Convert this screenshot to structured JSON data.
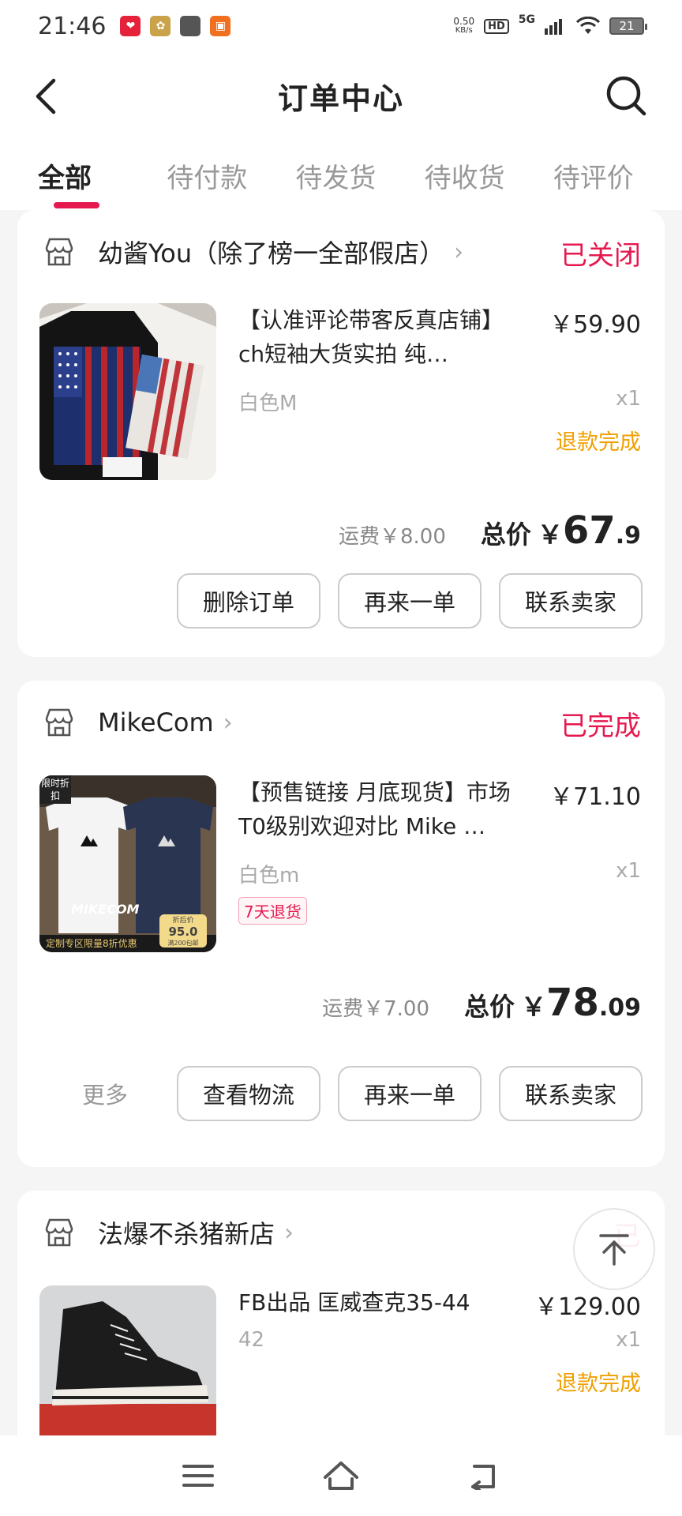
{
  "status_bar": {
    "time": "21:46",
    "net_speed_value": "0.50",
    "net_speed_unit": "KB/s",
    "hd": "HD",
    "network": "5G",
    "battery": "21"
  },
  "header": {
    "title": "订单中心"
  },
  "tabs": [
    {
      "label": "全部",
      "active": true
    },
    {
      "label": "待付款"
    },
    {
      "label": "待发货"
    },
    {
      "label": "待收货"
    },
    {
      "label": "待评价"
    }
  ],
  "orders": [
    {
      "shop_name": "幼酱You（除了榜一全部假店）",
      "status": "已关闭",
      "product_title": "【认准评论带客反真店铺】ch短袖大货实拍 纯…",
      "price": "￥59.90",
      "variant": "白色M",
      "qty": "x1",
      "refund_status": "退款完成",
      "shipping": "运费￥8.00",
      "total_label": "总价",
      "total_yen": "￥",
      "total_int": "67",
      "total_dec": ".9",
      "buttons": [
        "删除订单",
        "再来一单",
        "联系卖家"
      ]
    },
    {
      "shop_name": "MikeCom",
      "status": "已完成",
      "product_title": "【预售链接 月底现货】市场T0级别欢迎对比 Mike …",
      "price": "￥71.10",
      "variant": "白色m",
      "qty": "x1",
      "tag": "7天退货",
      "thumb_badge": "限时折扣",
      "thumb_brand": "MIKECOM",
      "thumb_banner": "定制专区限量8折优惠",
      "thumb_price_label": "折后价",
      "thumb_price": "95.0",
      "thumb_price_note": "满200包邮",
      "shipping": "运费￥7.00",
      "total_label": "总价",
      "total_yen": "￥",
      "total_int": "78",
      "total_dec": ".09",
      "more": "更多",
      "buttons": [
        "查看物流",
        "再来一单",
        "联系卖家"
      ]
    },
    {
      "shop_name": "法爆不杀猪新店",
      "status": "已",
      "product_title": "FB出品 匡威查克35-44",
      "price": "￥129.00",
      "variant": "42",
      "qty": "x1",
      "refund_status": "退款完成"
    }
  ],
  "colors": {
    "accent": "#e6194f",
    "refund": "#f0a000",
    "muted": "#999999"
  },
  "icons": [
    "back-arrow-icon",
    "search-icon",
    "shop-icon",
    "chevron-right-icon",
    "arrow-up-icon",
    "menu-icon",
    "home-icon",
    "back-icon"
  ]
}
